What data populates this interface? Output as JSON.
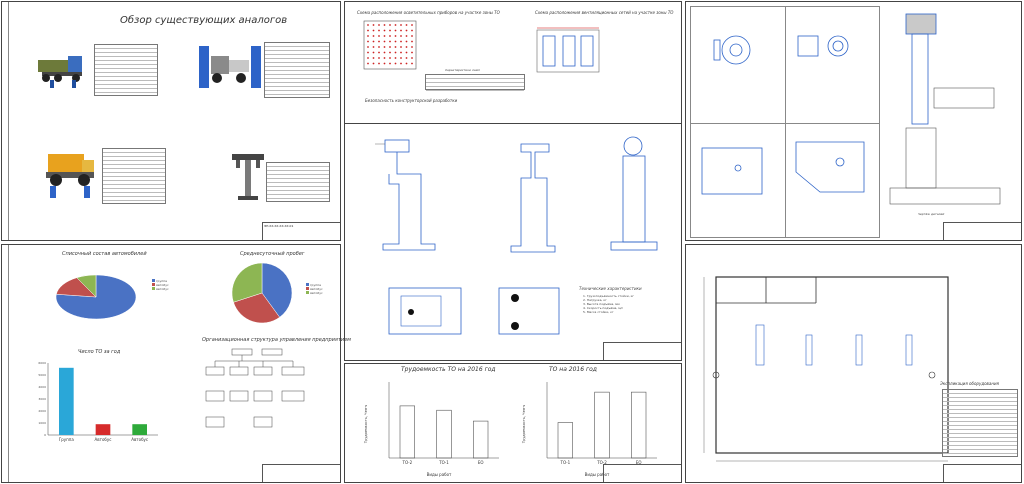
{
  "sheet1": {
    "title": "Обзор существующих аналогов",
    "code": "ЭП.ХХ.ХХ.ХХ.ХХ.01"
  },
  "sheet2": {
    "title_top_left": "Схема расположения осветительных приборов на участке зоны ТО",
    "title_top_right": "Схема расположения вентиляционных сетей на участке зоны ТО",
    "label_section": "Безопасность конструкторской разработки",
    "subtitle_chars": "Характеристики ламп",
    "tech_title": "Технические характеристики",
    "tech_lines": [
      "1. Грузоподъёмность стойки, кг",
      "2. Нагрузка, кг",
      "3. Высота подъёма, мм",
      "4. Скорость подъёма, м/с",
      "5. Масса стойки, кг"
    ]
  },
  "sheet3": {
    "title": "Чертёж деталей"
  },
  "sheet4": {
    "title_pie1": "Списочный состав автомобилей",
    "title_pie2": "Среднесуточный пробег",
    "title_org": "Организационная структура управления предприятием",
    "title_bar": "Число ТО за год",
    "pie1_legend": [
      "группа",
      "Автобус",
      "Автобус"
    ],
    "pie2_legend": [
      "группа",
      "Автобус",
      "Автобус"
    ],
    "bar_cats": [
      "Группа",
      "Автобус",
      "Автобус"
    ]
  },
  "sheet5": {
    "title_left": "Трудоемкость ТО на 2016 год",
    "title_right": "ТО на 2016 год",
    "ylabel": "Трудоемкость, Чел·ч",
    "xlabel": "Виды работ",
    "cats_left": [
      "ТО-2",
      "ТО-1",
      "ЕО"
    ],
    "cats_right": [
      "ТО-1",
      "ТО-2",
      "ЕО"
    ]
  },
  "sheet6": {
    "title": "Экспликация оборудования"
  },
  "chart_data": [
    {
      "type": "pie",
      "title": "Списочный состав автомобилей",
      "labels": [
        "группа",
        "Автобус",
        "Автобус"
      ],
      "values": [
        77,
        15,
        8
      ],
      "colors": [
        "#4a72c4",
        "#c0504d",
        "#8db653"
      ]
    },
    {
      "type": "pie",
      "title": "Среднесуточный пробег",
      "labels": [
        "группа",
        "Автобус",
        "Автобус"
      ],
      "values": [
        40,
        30,
        30
      ],
      "colors": [
        "#4a72c4",
        "#c0504d",
        "#8db653"
      ]
    },
    {
      "type": "bar",
      "title": "Число ТО за год",
      "categories": [
        "Группа",
        "Автобус",
        "Автобус"
      ],
      "values": [
        5600,
        900,
        900
      ],
      "colors": [
        "#2aa7d8",
        "#d62b2b",
        "#2eaa3a"
      ],
      "ylim": [
        0,
        6000
      ],
      "yticks": [
        0,
        1000,
        2000,
        3000,
        4000,
        5000,
        6000
      ]
    },
    {
      "type": "bar",
      "title": "Трудоемкость ТО на 2016 год",
      "categories": [
        "ТО-2",
        "ТО-1",
        "ЕО"
      ],
      "values": [
        2400,
        2200,
        1700
      ],
      "ylim": [
        0,
        3500
      ]
    },
    {
      "type": "bar",
      "title": "ТО на 2016 год",
      "categories": [
        "ТО-1",
        "ТО-2",
        "ЕО"
      ],
      "values": [
        1400,
        2600,
        2600
      ],
      "ylim": [
        0,
        3000
      ]
    }
  ]
}
